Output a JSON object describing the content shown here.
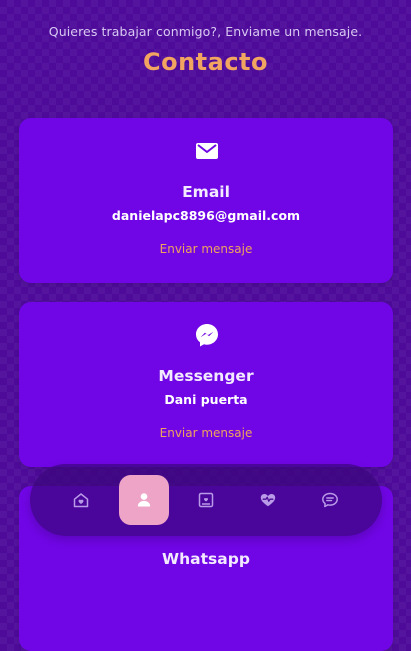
{
  "header": {
    "subtitle": "Quieres trabajar conmigo?, Enviame un mensaje.",
    "title": "Contacto"
  },
  "cards": [
    {
      "icon": "email-icon",
      "title": "Email",
      "value": "danielapc8896@gmail.com",
      "link": "Enviar mensaje"
    },
    {
      "icon": "messenger-icon",
      "title": "Messenger",
      "value": "Dani puerta",
      "link": "Enviar mensaje"
    },
    {
      "icon": "whatsapp-icon",
      "title": "Whatsapp"
    }
  ],
  "nav": {
    "items": [
      {
        "icon": "home-icon",
        "active": false
      },
      {
        "icon": "user-icon",
        "active": true
      },
      {
        "icon": "portfolio-icon",
        "active": false
      },
      {
        "icon": "services-icon",
        "active": false
      },
      {
        "icon": "chat-icon",
        "active": false
      }
    ]
  },
  "colors": {
    "background": "#4e0b9a",
    "card": "#7006e6",
    "accent": "#f1a560",
    "nav_active": "#eda4c7"
  }
}
